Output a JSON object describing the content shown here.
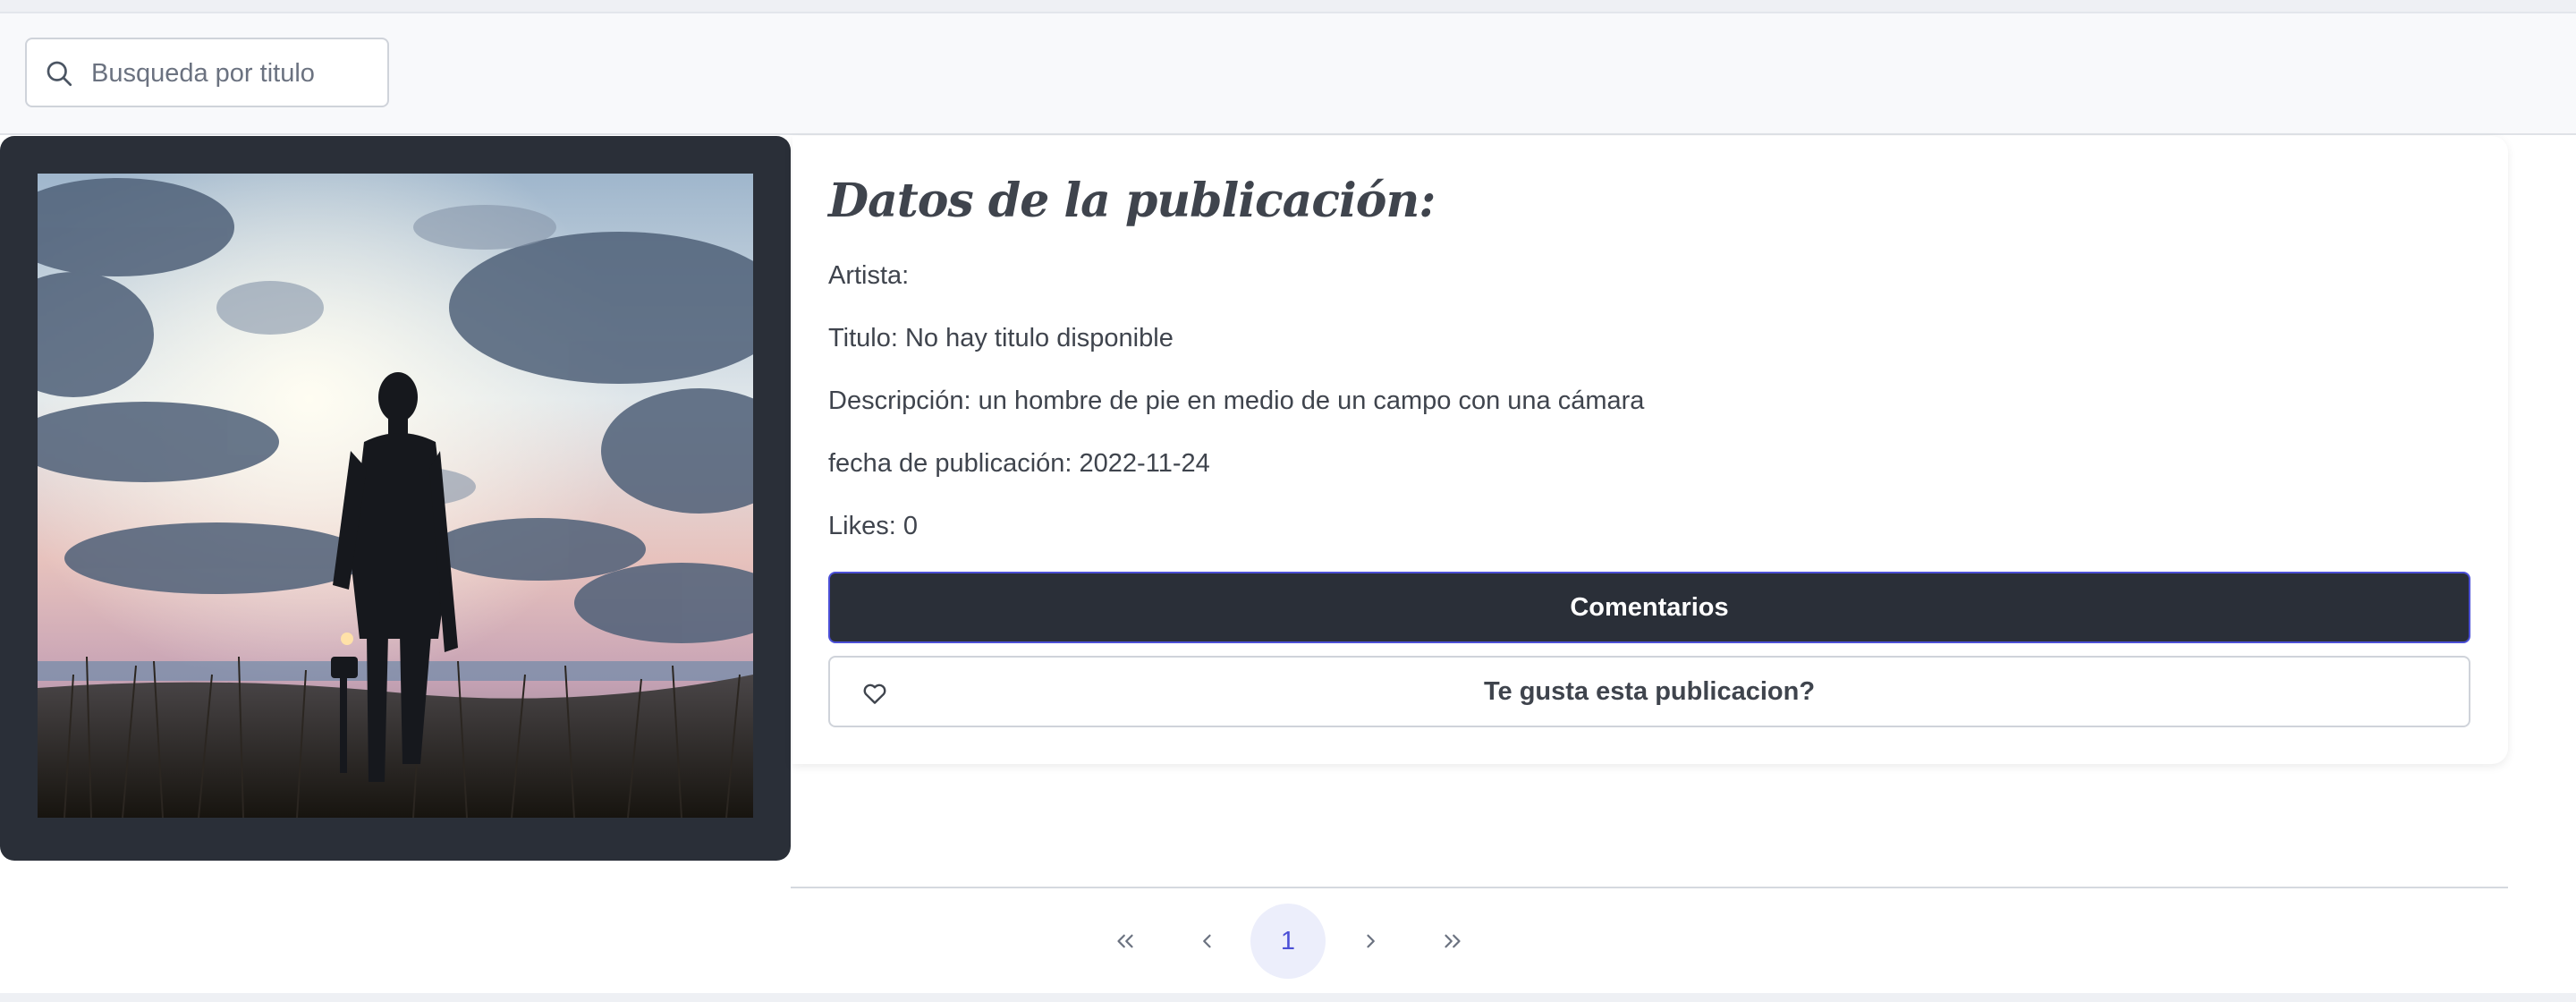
{
  "search": {
    "placeholder": "Busqueda por titulo",
    "value": ""
  },
  "publication": {
    "heading": "Datos de la publicación:",
    "artist_label": "Artista:",
    "artist_value": "",
    "title_label": "Titulo:",
    "title_value": "No hay titulo disponible",
    "description_label": "Descripción:",
    "description_value": "un hombre de pie en medio de un campo con una cámara",
    "date_label": "fecha de publicación:",
    "date_value": "2022-11-24",
    "likes_label": "Likes:",
    "likes_value": "0",
    "comments_button": "Comentarios",
    "like_button": "Te gusta esta publicacion?"
  },
  "pagination": {
    "current_page": "1"
  },
  "colors": {
    "dark_card": "#2a2f38",
    "accent": "#4b4fd6",
    "text": "#3f444d",
    "page_active_bg": "#eceefb"
  },
  "icons": {
    "search": "search-icon",
    "heart": "heart-icon",
    "first": "chevrons-left-icon",
    "prev": "chevron-left-icon",
    "next": "chevron-right-icon",
    "last": "chevrons-right-icon"
  }
}
